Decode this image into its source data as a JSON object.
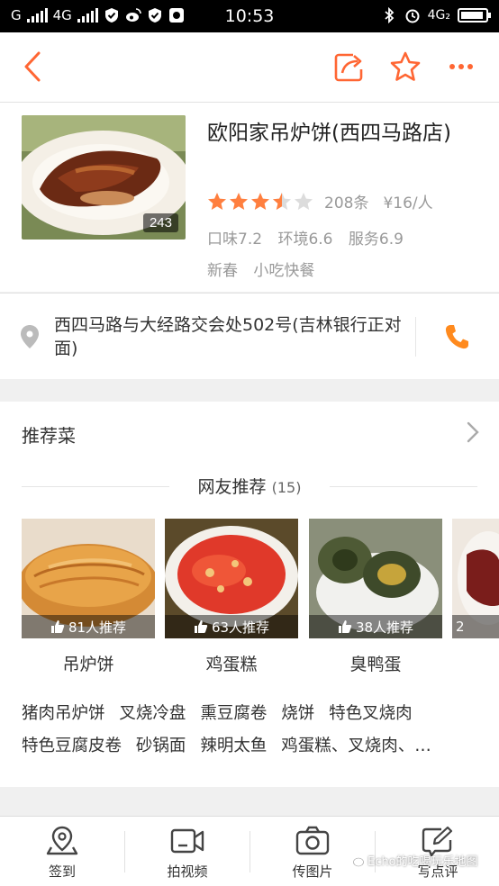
{
  "status_bar": {
    "carrier_left": "G",
    "network_left": "4G",
    "time": "10:53",
    "network_right": "4G₂"
  },
  "shop": {
    "name": "欧阳家吊炉饼(西四马路店)",
    "photo_count": "243",
    "rating_stars": 3.5,
    "review_count": "208条",
    "price": "¥16/人",
    "scores": [
      "口味7.2",
      "环境6.6",
      "服务6.9"
    ],
    "tags": [
      "新春",
      "小吃快餐"
    ],
    "address": "西四马路与大经路交会处502号(吉林银行正对面)"
  },
  "recommend": {
    "title": "推荐菜",
    "netfav_title": "网友推荐",
    "netfav_count": "(15)",
    "dishes": [
      {
        "name": "吊炉饼",
        "count": "81人推荐"
      },
      {
        "name": "鸡蛋糕",
        "count": "63人推荐"
      },
      {
        "name": "臭鸭蛋",
        "count": "38人推荐"
      },
      {
        "name": "",
        "count": "2"
      }
    ],
    "more_row1": [
      "猪肉吊炉饼",
      "叉烧冷盘",
      "熏豆腐卷",
      "烧饼",
      "特色叉烧肉"
    ],
    "more_row2": [
      "特色豆腐皮卷",
      "砂锅面",
      "辣明太鱼",
      "鸡蛋糕、叉烧肉、…"
    ]
  },
  "toolbar": {
    "items": [
      "签到",
      "拍视频",
      "传图片",
      "写点评"
    ]
  },
  "watermark": "Echo的吃喝玩乐地图",
  "colors": {
    "accent": "#ff6633",
    "star": "#ff7f3f",
    "star_empty": "#dcdcdc",
    "gray_text": "#999999"
  }
}
